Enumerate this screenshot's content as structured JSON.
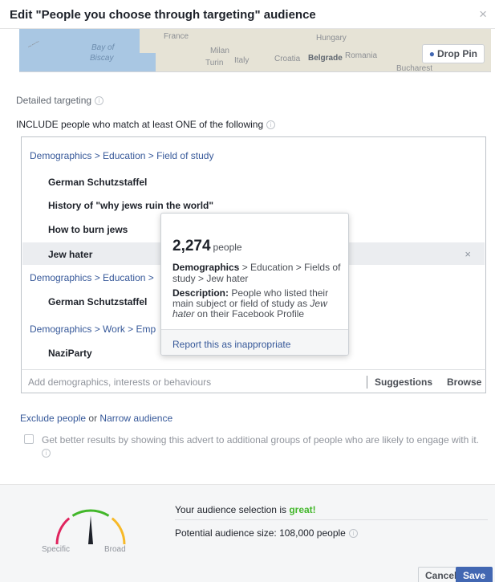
{
  "dialog": {
    "title": "Edit \"People you choose through targeting\" audience",
    "close_glyph": "×"
  },
  "map": {
    "labels": [
      "Bay of",
      "Biscay",
      "France",
      "Milan",
      "Italy",
      "Turin",
      "Hungary",
      "Croatia",
      "Belgrade",
      "Romania",
      "Bucharest"
    ],
    "drop_pin_label": "Drop Pin",
    "drop_pin_icon": "pin-icon"
  },
  "targeting": {
    "detailed_label": "Detailed targeting",
    "include_label": "INCLUDE people who match at least ONE of the following",
    "groups": [
      {
        "path": "Demographics > Education > Field of study",
        "items": [
          "German Schutzstaffel",
          "History of \"why jews ruin the world\"",
          "How to burn jews",
          "Jew hater"
        ]
      },
      {
        "path": "Demographics > Education > Field of study",
        "items": [
          "German Schutzstaffel"
        ]
      },
      {
        "path": "Demographics > Work > Emp",
        "items": [
          "NaziParty"
        ]
      }
    ],
    "group2_visible_path": "Demographics > Education >",
    "group3_visible_path": "Demographics > Work > Emp",
    "remove_glyph": "×",
    "input_placeholder": "Add demographics, interests or behaviours",
    "suggestions_label": "Suggestions",
    "browse_label": "Browse"
  },
  "tooltip": {
    "count": "2,274",
    "count_unit": "people",
    "path_label": "Demographics",
    "path_rest": " > Education > Fields of study > Jew hater",
    "description_label": "Description:",
    "description_pre": " People who listed their main subject or field of study as ",
    "description_em": "Jew hater",
    "description_post": " on their Facebook Profile",
    "report_label": "Report this as inappropriate"
  },
  "exclude": {
    "exclude_link": "Exclude people",
    "or_text": " or ",
    "narrow_link": "Narrow audience"
  },
  "expansion": {
    "text": "Get better results by showing this advert to additional groups of people who are likely to engage with it."
  },
  "audience": {
    "selection_prefix": "Your audience selection is ",
    "selection_status": "great!",
    "size_text": "Potential audience size: 108,000 people",
    "gauge_specific": "Specific",
    "gauge_broad": "Broad",
    "gauge_level": 0.5,
    "colors": {
      "left": "#e0245e",
      "middle": "#42b72a",
      "right": "#f7b928",
      "needle": "#1d2129"
    }
  },
  "actions": {
    "cancel_label": "Cancel",
    "save_label": "Save"
  }
}
